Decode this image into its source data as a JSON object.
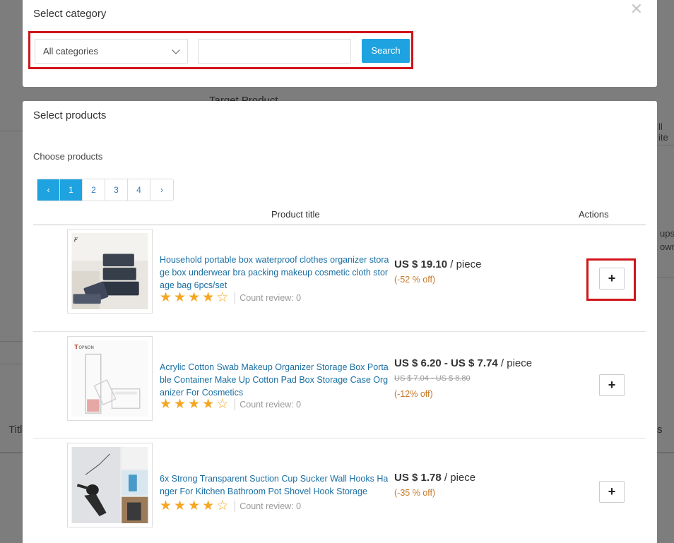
{
  "background": {
    "target_product": "Target Product",
    "all_items_fragment": "ll ite",
    "ups_fragment": "ups",
    "own_fragment": "own",
    "title_fragment": "Titl",
    "s_fragment": "s"
  },
  "category_modal": {
    "title": "Select category",
    "close_icon": "close-icon",
    "category_select_value": "All categories",
    "search_input_value": "",
    "search_button": "Search"
  },
  "products_modal": {
    "title": "Select products",
    "choose_label": "Choose products",
    "pagination": {
      "prev": "‹",
      "pages": [
        "1",
        "2",
        "3",
        "4"
      ],
      "next": "›",
      "active_page": "1"
    },
    "columns": {
      "product_title": "Product title",
      "actions": "Actions"
    },
    "products": [
      {
        "title": "Household portable box waterproof clothes organizer storage box underwear bra packing makeup cosmetic cloth storage bag 6pcs/set",
        "rating": 4,
        "rating_max": 5,
        "review_label": "Count review: 0",
        "price": "US $ 19.10",
        "unit": " / piece",
        "old_price": "",
        "discount": "(-52 % off)",
        "action": "+"
      },
      {
        "title": "Acrylic Cotton Swab Makeup Organizer Storage Box Portable Container Make Up Cotton Pad Box Storage Case Organizer For Cosmetics",
        "rating": 4,
        "rating_max": 5,
        "review_label": "Count review: 0",
        "price": "US $ 6.20 - US $ 7.74",
        "unit": " / piece",
        "old_price": "US $ 7.04 - US $ 8.80",
        "discount": "(-12% off)",
        "action": "+"
      },
      {
        "title": "6x Strong Transparent Suction Cup Sucker Wall Hooks Hanger For Kitchen Bathroom Pot Shovel Hook Storage",
        "rating": 4,
        "rating_max": 5,
        "review_label": "Count review: 0",
        "price": "US $ 1.78",
        "unit": " / piece",
        "old_price": "",
        "discount": "(-35 % off)",
        "action": "+"
      }
    ]
  },
  "colors": {
    "primary": "#1fa3e0",
    "highlight": "#d0141a",
    "star": "#f5a623",
    "discount": "#c7792a",
    "link": "#1a6fa3"
  }
}
